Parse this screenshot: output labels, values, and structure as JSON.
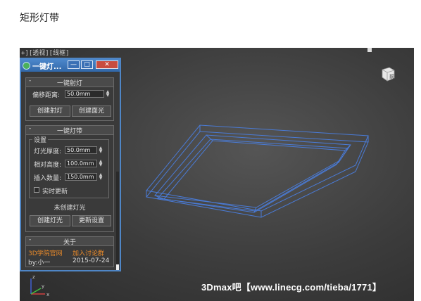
{
  "page_title": "矩形灯带",
  "viewport": {
    "label": "+][透视][线框]",
    "viewcube_label": "前",
    "watermark": "3Dmax吧【www.linecg.com/tieba/1771】",
    "wire_color": "#4a7bd6",
    "axis_x": "x",
    "axis_y": "y",
    "axis_z": "z"
  },
  "panel": {
    "title": "一键灯...",
    "min_label": "—",
    "max_label": "□",
    "close_label": "✕",
    "section1": {
      "title": "一键射灯",
      "collapse": "-",
      "offset_label": "偏移距离:",
      "offset_value": "50.0mm",
      "btn_create_spot": "创建射灯",
      "btn_create_area": "创建面光"
    },
    "section2": {
      "title": "一键灯带",
      "collapse": "-",
      "group_label": "设置",
      "thickness_label": "灯光厚度:",
      "thickness_value": "50.0mm",
      "height_label": "相对高度:",
      "height_value": "100.0mm",
      "insert_label": "插入数量:",
      "insert_value": "150.0mm",
      "realtime_label": "实时更新",
      "status": "未创建灯光",
      "btn_create_light": "创建灯光",
      "btn_update": "更新设置"
    },
    "section3": {
      "title": "关于",
      "collapse": "-",
      "site": "3D学院官网",
      "group": "加入讨论群",
      "author": "by:小一",
      "date": "2015-07-24"
    }
  }
}
